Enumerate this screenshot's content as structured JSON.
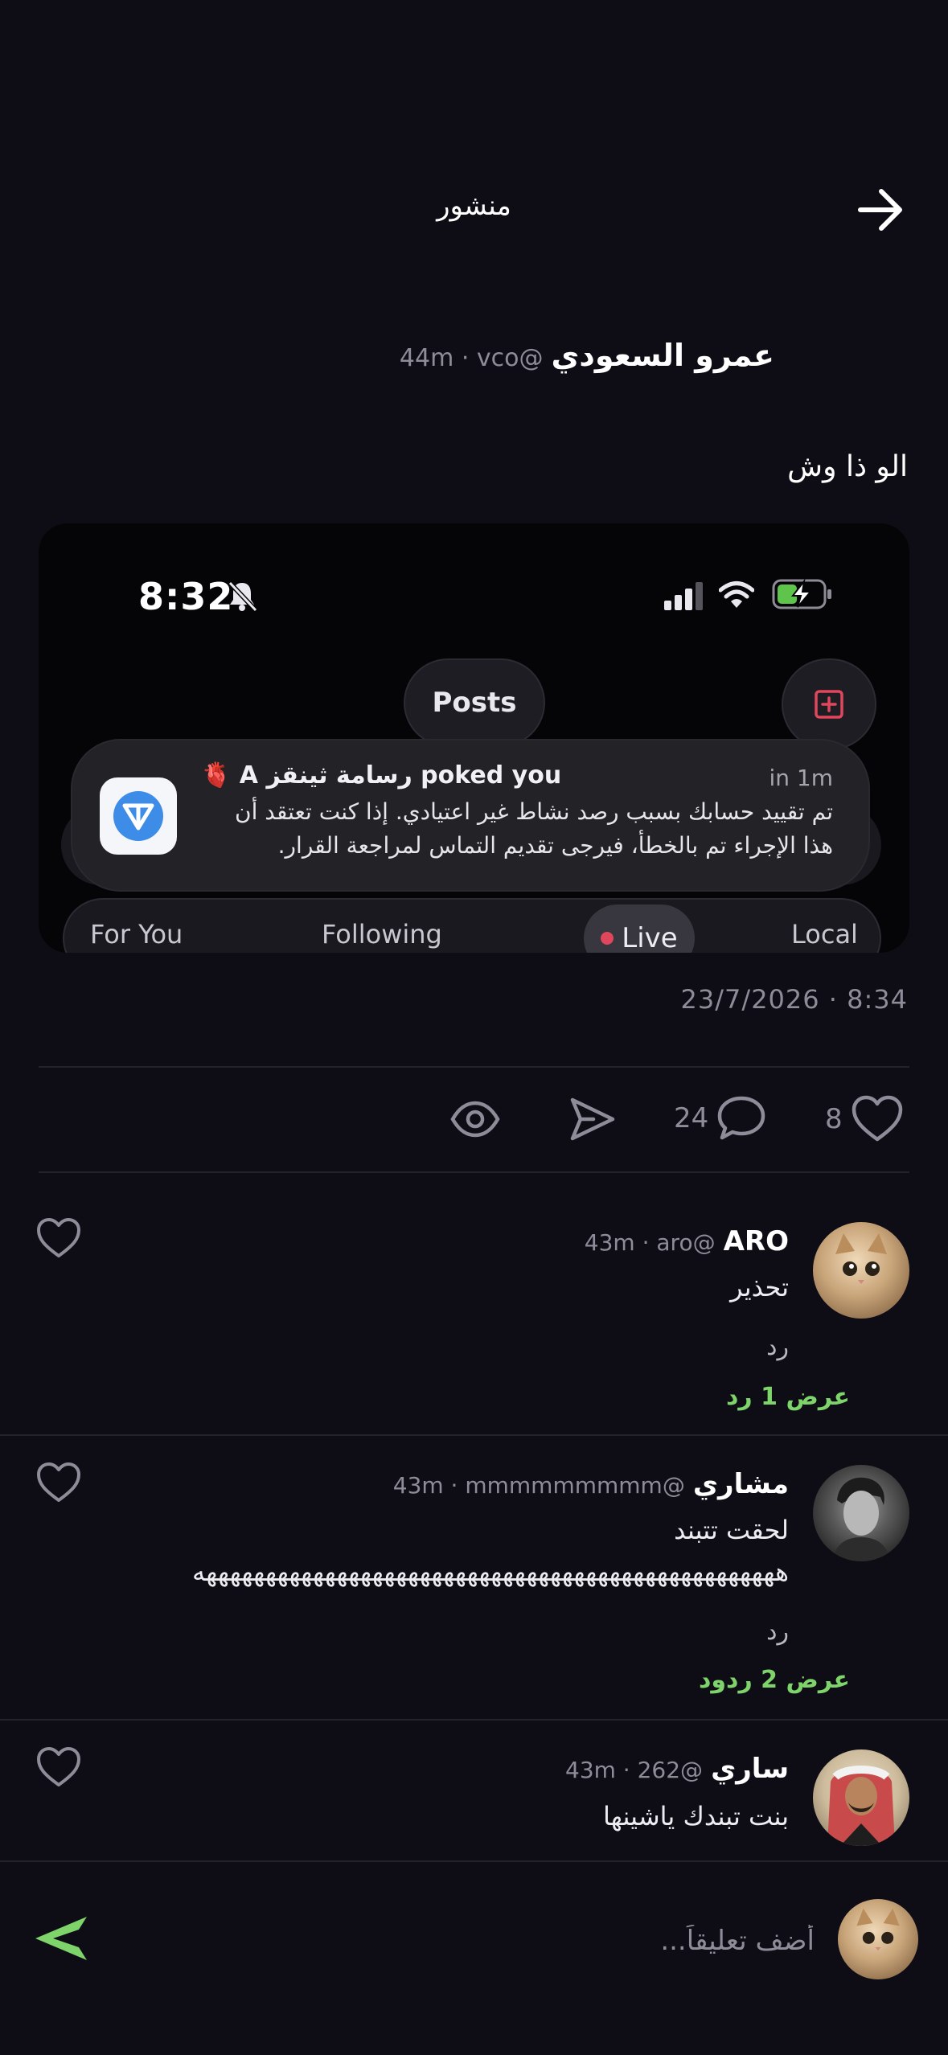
{
  "header": {
    "title": "منشور"
  },
  "post": {
    "author_name": "عمرو السعودي",
    "author_meta": "44m · vco@",
    "text": "الو ذا وش",
    "date": "23/7/2026 · 8:34",
    "likes": "8",
    "comments": "24"
  },
  "embed": {
    "time": "8:32",
    "posts_label": "Posts",
    "notification": {
      "title": "🫀 A رسامة ثينقز poked you",
      "time": "in 1m",
      "body": "تم تقييد حسابك بسبب رصد نشاط غير اعتيادي. إذا كنت تعتقد أن هذا الإجراء تم بالخطأ، فيرجى تقديم التماس لمراجعة القرار."
    },
    "tabs": [
      "For You",
      "Following",
      "Live",
      "Local"
    ]
  },
  "comments": [
    {
      "name": "ARO",
      "meta": "43m · aro@",
      "text": "تحذير",
      "reply": "رد",
      "show_replies": "عرض 1 رد"
    },
    {
      "name": "مشاري",
      "meta": "43m · mmmmmmmmm@",
      "text": "لحقت تتبند",
      "text2": "هههههههههههههههههههههههههههههههههههههههههههههههههه",
      "reply": "رد",
      "show_replies": "عرض 2 ردود"
    },
    {
      "name": "ساري",
      "meta": "43m · 262@",
      "text": "بنت تبندك ياشينها"
    }
  ],
  "composer": {
    "placeholder": "أضف تعليقاً..."
  },
  "colors": {
    "background": "#0e0d15",
    "accent_green": "#7ed36a",
    "muted": "#8e8c99",
    "live_red": "#e0475c"
  }
}
